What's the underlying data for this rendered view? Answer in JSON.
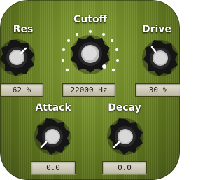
{
  "knobs": {
    "res": {
      "label": "Res",
      "readout": "62 %"
    },
    "cutoff": {
      "label": "Cutoff",
      "readout": "22000 Hz"
    },
    "drive": {
      "label": "Drive",
      "readout": "30 %"
    },
    "attack": {
      "label": "Attack",
      "readout": "0.0"
    },
    "decay": {
      "label": "Decay",
      "readout": "0.0"
    }
  },
  "colors": {
    "panel": "#6f8a28",
    "knob_body": "#161616",
    "knob_cap": "#cfcfcf",
    "indicator": "#ffffff",
    "readout_bg": "#d6d3c0"
  }
}
